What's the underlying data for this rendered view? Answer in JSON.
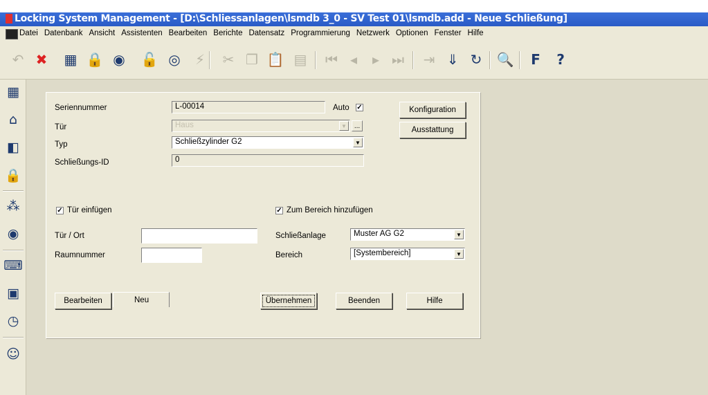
{
  "window": {
    "title": "Locking System Management - [D:\\Schliessanlagen\\lsmdb 3_0 - SV Test 01\\lsmdb.add - Neue Schließung]"
  },
  "menu": {
    "items": [
      "Datei",
      "Datenbank",
      "Ansicht",
      "Assistenten",
      "Bearbeiten",
      "Berichte",
      "Datensatz",
      "Programmierung",
      "Netzwerk",
      "Optionen",
      "Fenster",
      "Hilfe"
    ]
  },
  "toolbar": {
    "icons": [
      "undo-icon",
      "delete-icon",
      "new-transponder-icon",
      "new-lock-icon",
      "new-group-icon",
      "lock-properties-icon",
      "transponder-properties-icon",
      "program-icon",
      "cut-icon",
      "copy-icon",
      "paste-icon",
      "print-icon",
      "first-record-icon",
      "prev-record-icon",
      "next-record-icon",
      "last-record-icon",
      "delete-record-icon",
      "import-icon",
      "refresh-icon",
      "search-icon",
      "filter-icon",
      "help-icon"
    ]
  },
  "form": {
    "seriennummer_label": "Seriennummer",
    "seriennummer_value": "L-00014",
    "auto_label": "Auto",
    "auto_checked": true,
    "tuer_label": "Tür",
    "tuer_value": "Haus",
    "typ_label": "Typ",
    "typ_value": "Schließzylinder G2",
    "schliessungs_id_label": "Schließungs-ID",
    "schliessungs_id_value": "0",
    "konfiguration_button": "Konfiguration",
    "ausstattung_button": "Ausstattung",
    "tuer_einfuegen_label": "Tür einfügen",
    "tuer_einfuegen_checked": true,
    "zum_bereich_label": "Zum Bereich hinzufügen",
    "zum_bereich_checked": true,
    "tuer_ort_label": "Tür / Ort",
    "tuer_ort_value": "",
    "raumnummer_label": "Raumnummer",
    "raumnummer_value": "",
    "schliessanlage_label": "Schließanlage",
    "schliessanlage_value": "Muster AG G2",
    "bereich_label": "Bereich",
    "bereich_value": "[Systembereich]",
    "bearbeiten_tab": "Bearbeiten",
    "neu_tab": "Neu",
    "uebernehmen_button": "Übernehmen",
    "beenden_button": "Beenden",
    "hilfe_button": "Hilfe",
    "ellipsis_button": "..."
  }
}
